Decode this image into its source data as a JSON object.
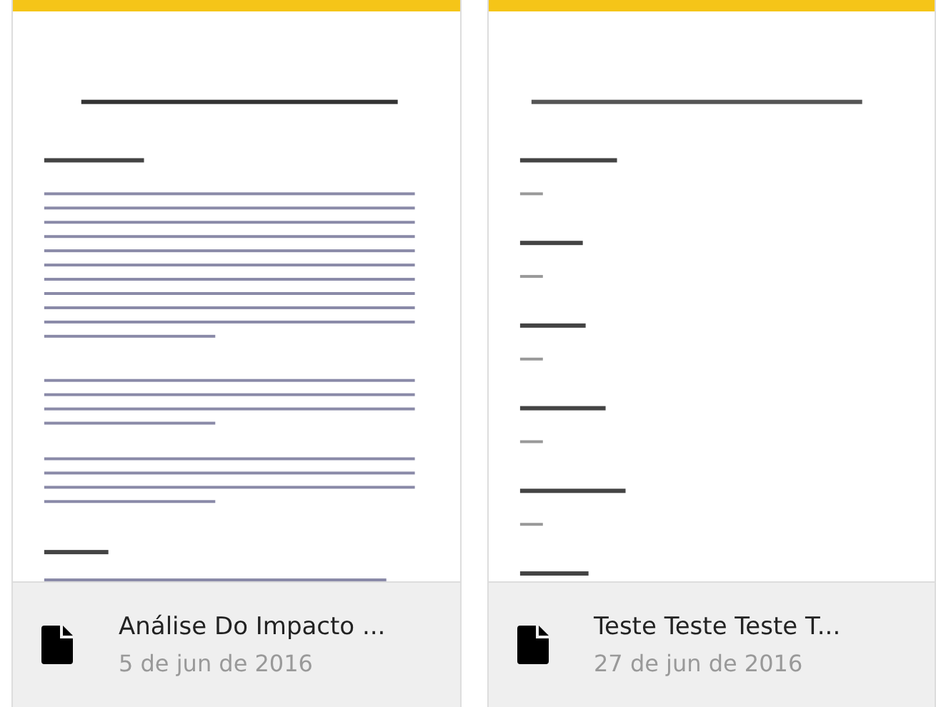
{
  "documents": [
    {
      "title": "Análise Do Impacto ...",
      "date": "5 de jun de 2016",
      "kind": "essay"
    },
    {
      "title": "Teste Teste Teste T...",
      "date": "27 de jun de 2016",
      "kind": "outline"
    }
  ]
}
